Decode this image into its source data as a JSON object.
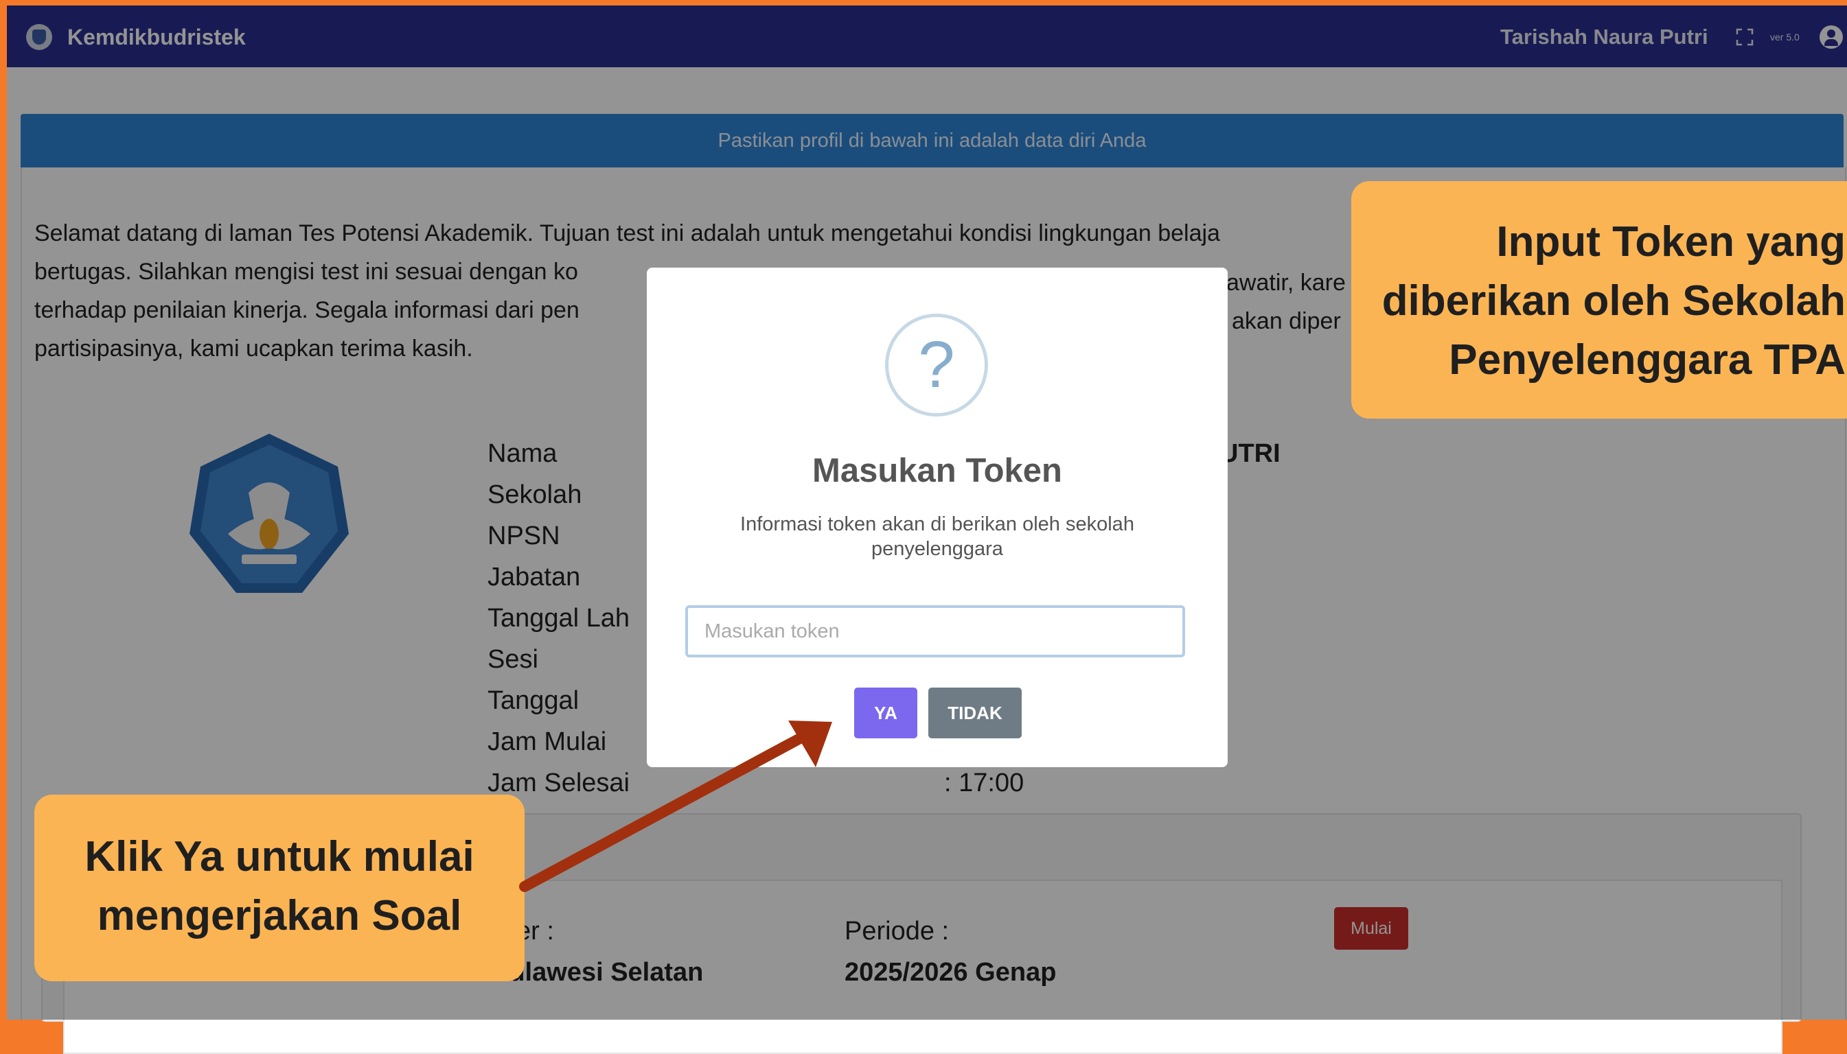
{
  "navbar": {
    "brand": "Kemdikbudristek",
    "user": "Tarishah Naura Putri",
    "version": "ver 5.0"
  },
  "card": {
    "header": "Pastikan profil di bawah ini adalah data diri Anda"
  },
  "intro_lines": [
    "Selamat datang di laman Tes Potensi Akademik. Tujuan test ini adalah untuk mengetahui kondisi lingkungan belaja",
    "bertugas. Silahkan mengisi test ini sesuai dengan ko",
    "terhadap penilaian kinerja. Segala informasi dari pen",
    "partisipasinya, kami ucapkan terima kasih."
  ],
  "intro_right_fragments": [
    "awatir, kare",
    "akan diper"
  ],
  "profile": {
    "labels": [
      "Nama",
      "Sekolah",
      "NPSN",
      "Jabatan",
      "Tanggal Lah",
      "Sesi",
      "Tanggal",
      "Jam Mulai",
      "Jam Selesai"
    ],
    "name_fragment": "UTRI",
    "jam_selesai": ": 17:00"
  },
  "exam": {
    "label_1": "er :",
    "value_1": "Sulawesi Selatan",
    "label_2": "Periode :",
    "value_2": "2025/2026 Genap",
    "start_button": "Mulai"
  },
  "modal": {
    "icon": "?",
    "title": "Masukan Token",
    "text": "Informasi token akan di berikan oleh sekolah penyelenggara",
    "input_placeholder": "Masukan token",
    "input_value": "",
    "confirm": "YA",
    "cancel": "TIDAK"
  },
  "callouts": {
    "right": [
      "Input Token yang",
      "diberikan oleh Sekolah",
      "Penyelenggara TPA"
    ],
    "left": [
      "Klik Ya untuk mulai",
      "mengerjakan Soal"
    ]
  },
  "colors": {
    "navbar": "#2a2f8f",
    "card_header": "#2f86d6",
    "callout": "#fbb454",
    "arrow": "#a2300e",
    "border": "#f47a2a"
  }
}
